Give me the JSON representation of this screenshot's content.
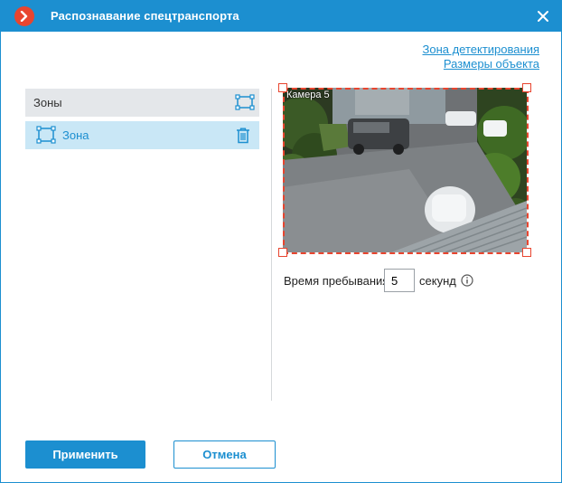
{
  "window": {
    "title": "Распознавание спецтранспорта"
  },
  "links": {
    "detection_zone": "Зона детектирования",
    "object_size": "Размеры объекта"
  },
  "zones": {
    "header_label": "Зоны",
    "items": [
      {
        "label": "Зона",
        "selected": true
      }
    ]
  },
  "preview": {
    "camera_label": "Камера 5"
  },
  "dwell": {
    "label": "Время пребывания",
    "value": "5",
    "unit": "секунд"
  },
  "buttons": {
    "apply": "Применить",
    "cancel": "Отмена"
  },
  "colors": {
    "accent": "#1c8fd0",
    "zone_outline": "#e8452f",
    "selected_row": "#c9e7f6"
  },
  "icons": {
    "logo": "app-logo-icon",
    "close": "close-icon",
    "add_zone": "zone-frame-icon",
    "zone": "zone-frame-icon",
    "delete": "trash-icon",
    "info": "info-icon"
  }
}
